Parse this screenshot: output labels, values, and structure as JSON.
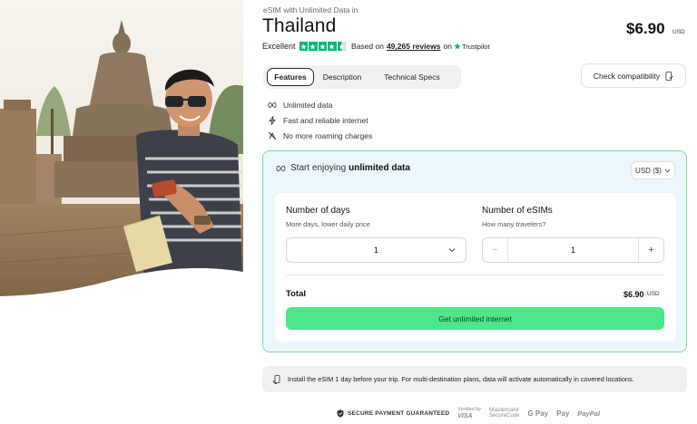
{
  "product": {
    "subtitle": "eSIM with Unlimited Data in",
    "title": "Thailand",
    "price": "$6.90",
    "price_currency": "USD"
  },
  "rating": {
    "label": "Excellent",
    "stars": 4.5,
    "based_on": "Based on",
    "reviews": "49,265 reviews",
    "on": "on",
    "provider": "Trustpilot"
  },
  "tabs": [
    {
      "label": "Features",
      "active": true
    },
    {
      "label": "Description",
      "active": false
    },
    {
      "label": "Technical Specs",
      "active": false
    }
  ],
  "compat_button": {
    "label": "Check compatibility",
    "icon": "phone-check-icon"
  },
  "features": [
    {
      "icon": "infinity-icon",
      "label": "Unlimited data"
    },
    {
      "icon": "lightning-icon",
      "label": "Fast and reliable internet"
    },
    {
      "icon": "no-roaming-icon",
      "label": "No more roaming charges"
    }
  ],
  "card": {
    "head_prefix": "Start enjoying",
    "head_bold": "unlimited data",
    "currency_select": "USD ($)",
    "days": {
      "label": "Number of days",
      "hint": "More days, lower daily price",
      "value": "1"
    },
    "esims": {
      "label": "Number of eSIMs",
      "hint": "How many travelers?",
      "value": "1",
      "minus": "−",
      "plus": "+"
    },
    "total_label": "Total",
    "total_value": "$6.90",
    "total_currency": "USD",
    "buy_label": "Get unlimited internet"
  },
  "info": {
    "icon": "hand-phone-icon",
    "text": "Install the eSIM 1 day before your trip. For multi-destination plans, data will activate automatically in covered locations."
  },
  "payment": {
    "secure_label": "SECURE PAYMENT GUARANTEED",
    "visa_l1": "Verified by",
    "visa_l2": "VISA",
    "mc_l1": "Mastercard",
    "mc_l2": "SecureCode",
    "gpay": "G Pay",
    "applepay": " Pay",
    "paypal": "PayPal"
  },
  "colors": {
    "accent_green": "#4ee68a",
    "card_border": "#7bd89b",
    "card_bg": "#ecf7fb",
    "trustpilot_green": "#00b67a"
  }
}
